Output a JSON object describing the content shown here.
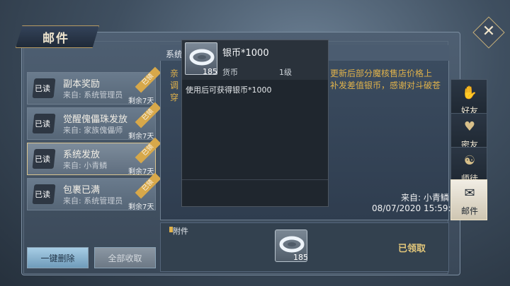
{
  "window": {
    "title": "邮件",
    "close_symbol": "✕"
  },
  "mails": [
    {
      "title": "副本奖励",
      "from": "来自: 系统管理员",
      "remaining": "剩余7天",
      "status": "已读",
      "ribbon": "已领"
    },
    {
      "title": "觉醒傀儡珠发放",
      "from": "来自: 家族傀儡师",
      "remaining": "剩余7天",
      "status": "已读",
      "ribbon": "已领"
    },
    {
      "title": "系统发放",
      "from": "来自: 小青鳞",
      "remaining": "剩余7天",
      "status": "已读",
      "ribbon": "已领"
    },
    {
      "title": "包裹已满",
      "from": "来自: 系统管理员",
      "remaining": "剩余7天",
      "status": "已读",
      "ribbon": "已领"
    }
  ],
  "buttons": {
    "delete_all": "一键删除",
    "collect_all": "全部收取"
  },
  "detail": {
    "subject": "系统",
    "body_left": [
      "亲",
      "调",
      "穿"
    ],
    "body_right": [
      "更新后部分魔核售店价格上",
      "补发差值银币，感谢对斗破苍",
      ""
    ],
    "sender": "来自: 小青鳞",
    "date": "08/07/2020 15:59:47"
  },
  "attachment": {
    "label": "附件",
    "count": "185",
    "claimed": "已领取"
  },
  "tooltip": {
    "name": "银币*1000",
    "type": "货币",
    "level": "1级",
    "count": "185",
    "desc": "使用后可获得银币*1000"
  },
  "side_tabs": [
    {
      "label": "好友",
      "icon": "handshake-icon",
      "active": false
    },
    {
      "label": "密友",
      "icon": "handshake-heart-icon",
      "active": false
    },
    {
      "label": "师徒",
      "icon": "master-apprentice-icon",
      "active": false
    },
    {
      "label": "邮件",
      "icon": "mail-icon",
      "active": true
    }
  ],
  "colors": {
    "accent_gold": "#e0b24b",
    "selected_border": "#d9c48f"
  }
}
